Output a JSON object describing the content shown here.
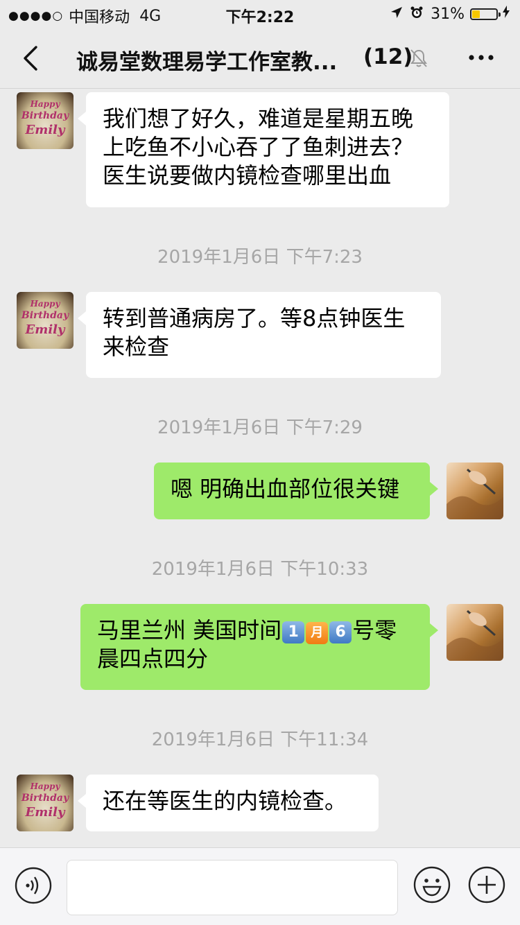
{
  "status_bar": {
    "signal": "●●●●○",
    "carrier": "中国移动",
    "network": "4G",
    "time": "下午2:22",
    "battery_percent": "31%",
    "battery_level": 0.31,
    "icons": [
      "location-arrow-icon",
      "alarm-clock-icon",
      "battery-icon",
      "charging-icon"
    ]
  },
  "nav": {
    "title": "诚易堂数理易学工作室教...",
    "count": "(12)",
    "icons": [
      "back-chevron-icon",
      "mute-bell-icon",
      "more-dots-icon"
    ]
  },
  "messages": [
    {
      "side": "left",
      "avatar": "cake-avatar",
      "text": "我们想了好久，难道是星期五晚上吃鱼不小心吞了了鱼刺进去？医生说要做内镜检查哪里出血"
    },
    {
      "timestamp": "2019年1月6日 下午7:23"
    },
    {
      "side": "left",
      "avatar": "cake-avatar",
      "text": "转到普通病房了。等8点钟医生来检查"
    },
    {
      "timestamp": "2019年1月6日 下午7:29"
    },
    {
      "side": "right",
      "avatar": "carving-avatar",
      "text": "嗯 明确出血部位很关键"
    },
    {
      "timestamp": "2019年1月6日 下午10:33"
    },
    {
      "side": "right",
      "avatar": "carving-avatar",
      "text_parts": [
        "马里兰州 美国时间",
        "1",
        "月",
        "6",
        "号零晨四点四分"
      ]
    },
    {
      "timestamp": "2019年1月6日 下午11:34"
    },
    {
      "side": "left",
      "avatar": "cake-avatar",
      "text": "还在等医生的内镜检查。"
    }
  ],
  "avatar_text": {
    "line1": "Happy",
    "line2": "Birthday",
    "line3": "Emily"
  },
  "input_bar": {
    "placeholder": "",
    "icons": [
      "voice-icon",
      "emoji-icon",
      "plus-icon"
    ]
  },
  "colors": {
    "background": "#ebebeb",
    "bubble_mine": "#9eea6a",
    "bubble_other": "#ffffff",
    "timestamp": "#a6a6a6"
  }
}
